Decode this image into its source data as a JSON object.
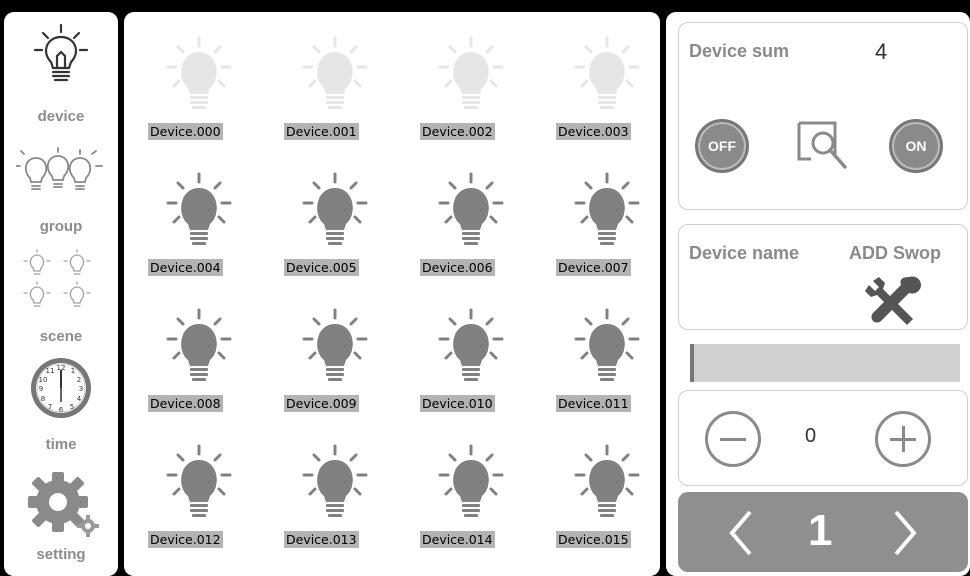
{
  "sidebar": {
    "items": [
      {
        "label": "device",
        "icon": "lightbulb-icon"
      },
      {
        "label": "group",
        "icon": "group-bulbs-icon"
      },
      {
        "label": "scene",
        "icon": "scene-bulbs-icon"
      },
      {
        "label": "time",
        "icon": "clock-icon"
      },
      {
        "label": "setting",
        "icon": "gear-icon"
      }
    ]
  },
  "devices": [
    {
      "name": "Device.000",
      "state": "off"
    },
    {
      "name": "Device.001",
      "state": "off"
    },
    {
      "name": "Device.002",
      "state": "off"
    },
    {
      "name": "Device.003",
      "state": "off"
    },
    {
      "name": "Device.004",
      "state": "on"
    },
    {
      "name": "Device.005",
      "state": "on"
    },
    {
      "name": "Device.006",
      "state": "on"
    },
    {
      "name": "Device.007",
      "state": "on"
    },
    {
      "name": "Device.008",
      "state": "on"
    },
    {
      "name": "Device.009",
      "state": "on"
    },
    {
      "name": "Device.010",
      "state": "on"
    },
    {
      "name": "Device.011",
      "state": "on"
    },
    {
      "name": "Device.012",
      "state": "on"
    },
    {
      "name": "Device.013",
      "state": "on"
    },
    {
      "name": "Device.014",
      "state": "on"
    },
    {
      "name": "Device.015",
      "state": "on"
    }
  ],
  "panel": {
    "device_sum_label": "Device sum",
    "device_sum_value": "4",
    "off_label": "OFF",
    "on_label": "ON",
    "device_name_label": "Device name",
    "add_swop_label": "ADD Swop",
    "stepper_value": "0",
    "page_number": "1"
  },
  "colors": {
    "icon_active": "#808080",
    "icon_inactive": "#e6e6e6",
    "label_bg": "#b3b3b3",
    "pager_bg": "#8f8f8f"
  }
}
